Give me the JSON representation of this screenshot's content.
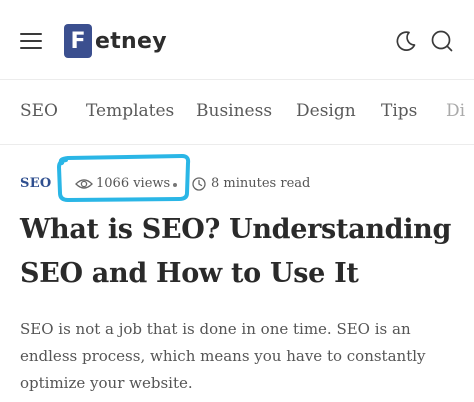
{
  "header": {
    "logo_letter": "F",
    "logo_rest": "etney",
    "icons": {
      "menu": "hamburger-icon",
      "theme": "moon-icon",
      "search": "search-icon"
    }
  },
  "categories": [
    "SEO",
    "Templates",
    "Business",
    "Design",
    "Tips",
    "Di"
  ],
  "post": {
    "tag": "SEO",
    "views": "1066 views",
    "read_time": "8 minutes read",
    "title": "What is SEO? Understanding SEO and How to Use It",
    "summary": "SEO is not a job that is done in one time. SEO is an endless process, which means you have to constantly optimize your website."
  },
  "colors": {
    "brand": "#3b4f8f",
    "tag": "#2f4f8f",
    "highlight": "#2ab6e6"
  }
}
